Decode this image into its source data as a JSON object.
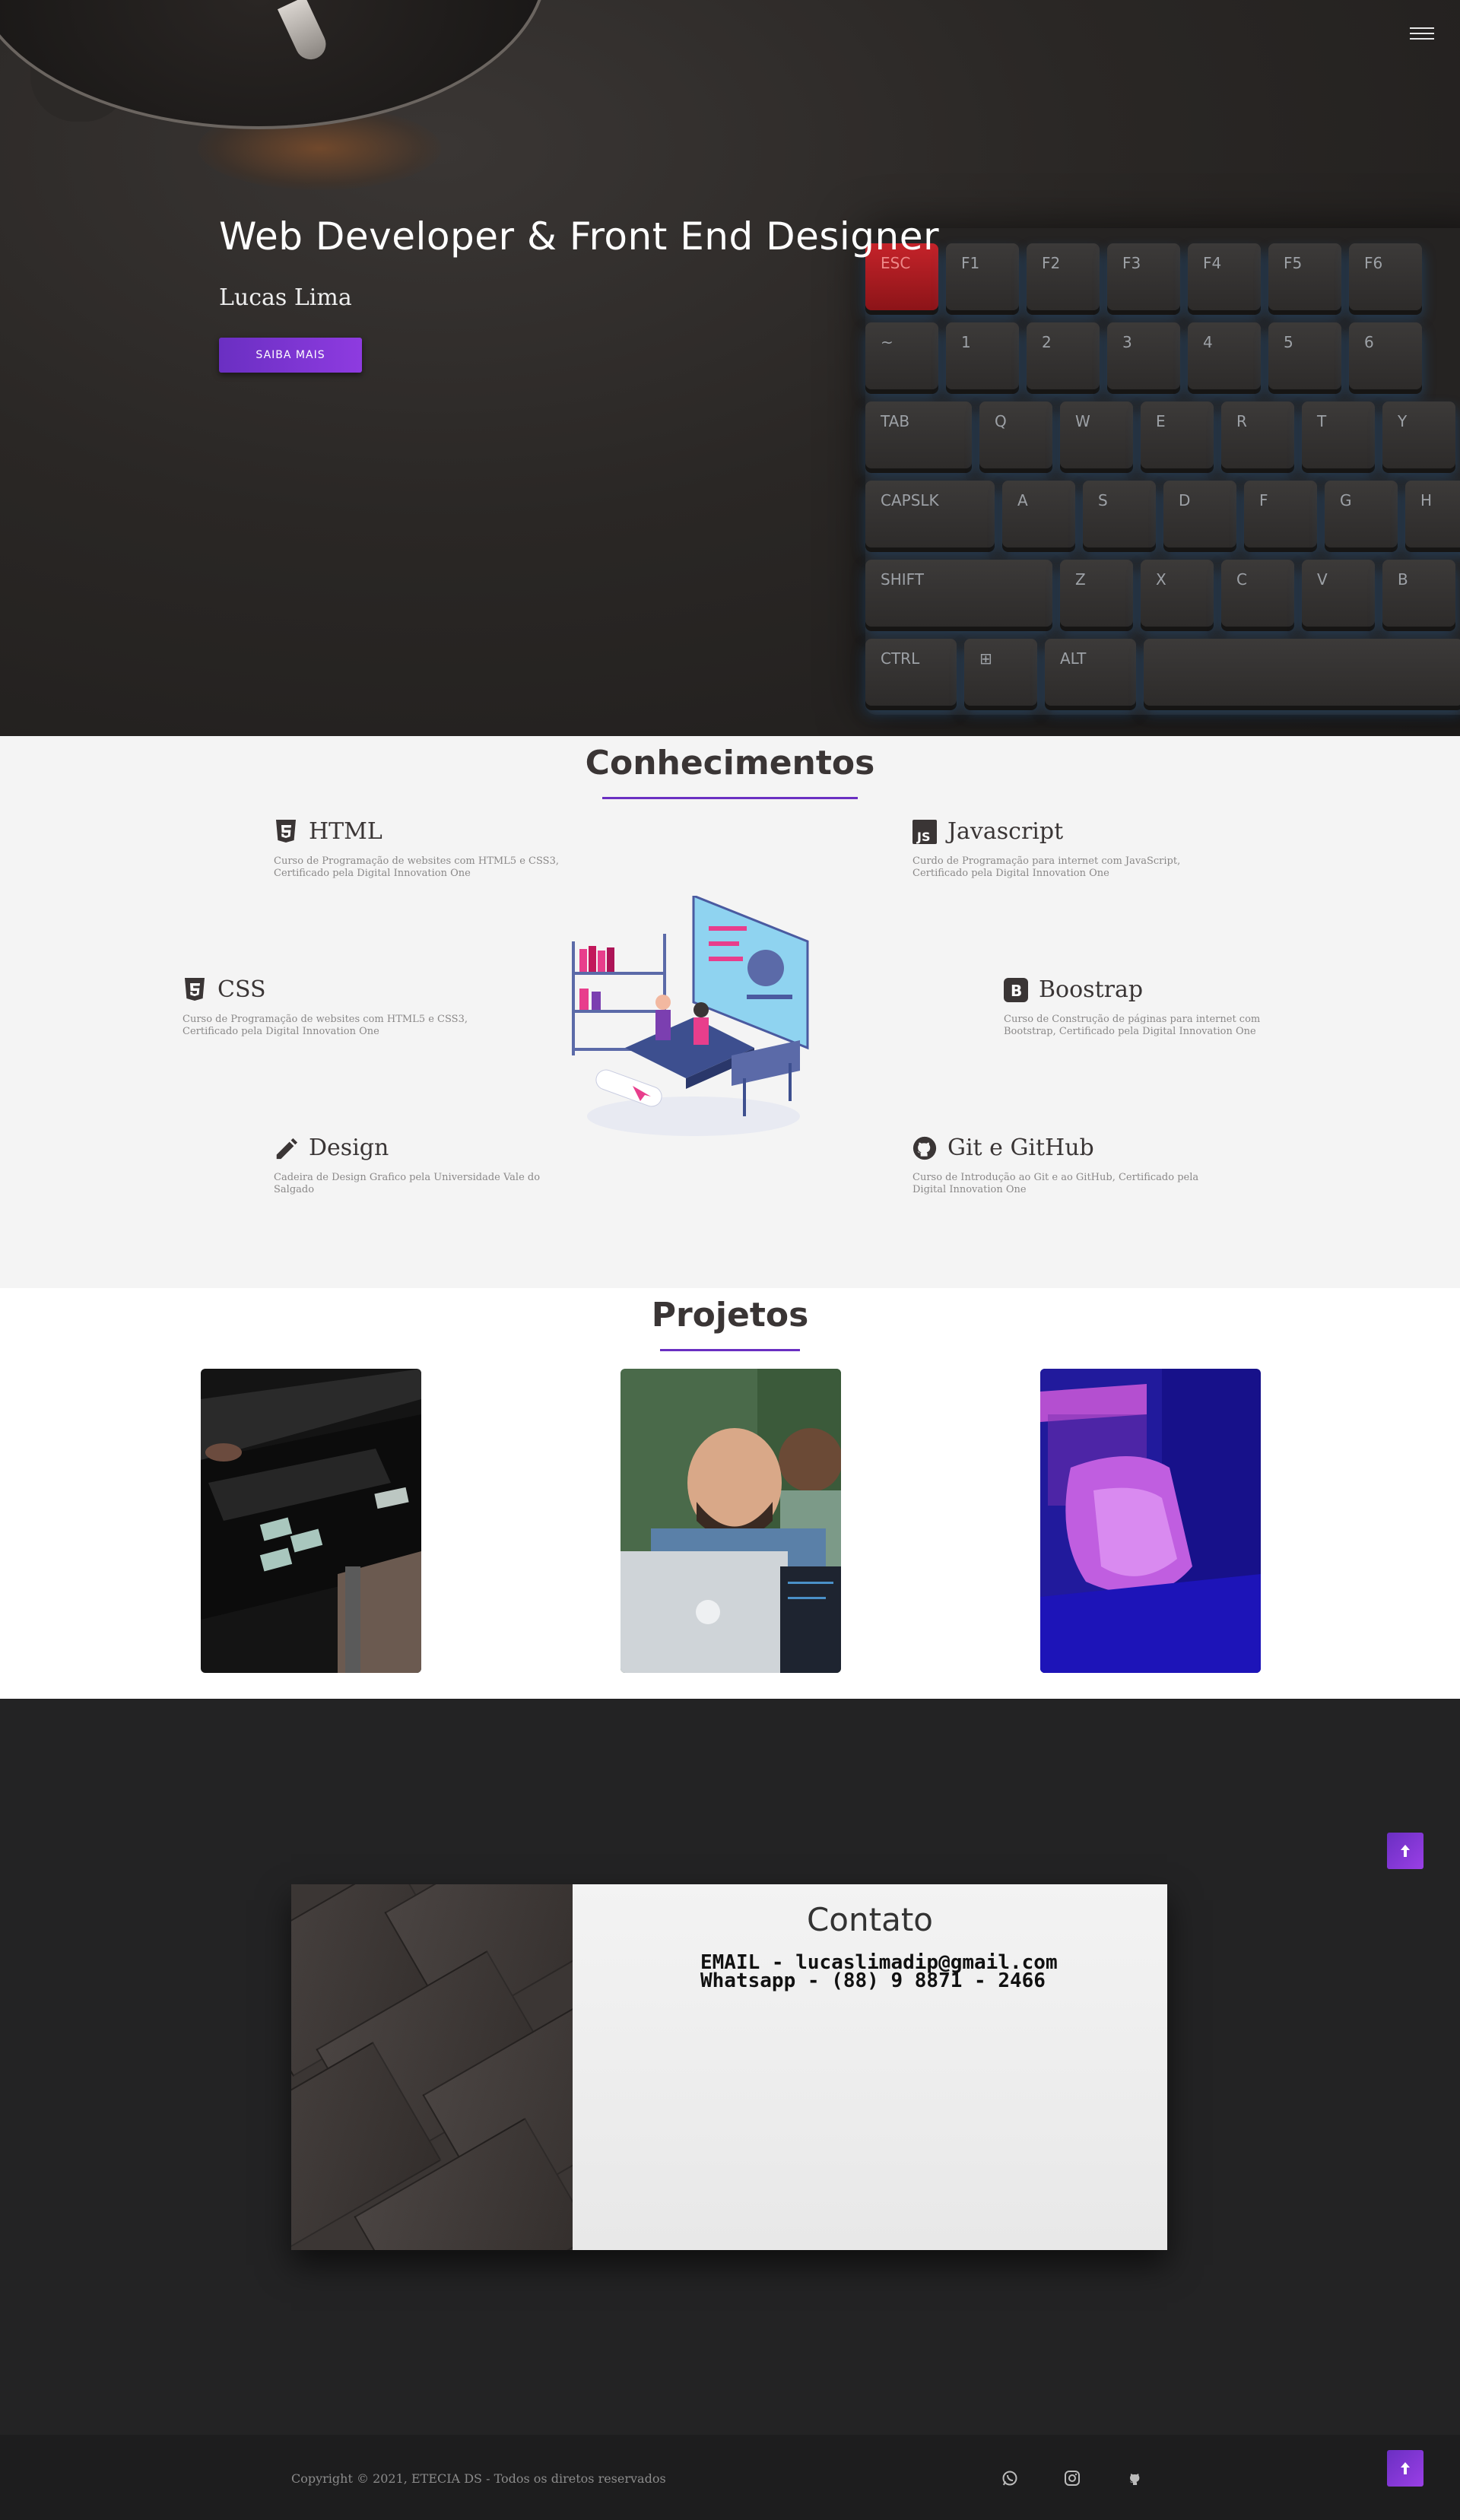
{
  "hero": {
    "title": "Web Developer & Front End Designer",
    "subtitle": "Lucas Lima",
    "cta_label": "SAIBA MAIS",
    "keys": {
      "row1": [
        "ESC",
        "F1",
        "F2",
        "F3",
        "F4",
        "F5",
        "F6"
      ],
      "row2": [
        "~",
        "1",
        "2",
        "3",
        "4",
        "5",
        "6"
      ],
      "row3": [
        "TAB",
        "Q",
        "W",
        "E",
        "R",
        "T",
        "Y"
      ],
      "row4": [
        "CAPSLK",
        "A",
        "S",
        "D",
        "F",
        "G",
        "H"
      ],
      "row5": [
        "SHIFT",
        "Z",
        "X",
        "C",
        "V",
        "B"
      ],
      "row6": [
        "CTRL",
        "⊞",
        "ALT",
        ""
      ]
    }
  },
  "skills": {
    "title": "Conhecimentos",
    "items": [
      {
        "name": "HTML",
        "icon": "html5-icon",
        "desc": "Curso de Programação de websites com HTML5 e CSS3, Certificado pela Digital Innovation One"
      },
      {
        "name": "Javascript",
        "icon": "js-icon",
        "desc": "Curdo de Programação para internet com JavaScript, Certificado pela Digital Innovation One"
      },
      {
        "name": "CSS",
        "icon": "css3-icon",
        "desc": "Curso de Programação de websites com HTML5 e CSS3, Certificado pela Digital Innovation One"
      },
      {
        "name": "Boostrap",
        "icon": "bootstrap-icon",
        "desc": "Curso de Construção de páginas para internet com Bootstrap, Certificado pela Digital Innovation One"
      },
      {
        "name": "Design",
        "icon": "pencil-icon",
        "desc": "Cadeira de Design Grafico pela Universidade Vale do Salgado"
      },
      {
        "name": "Git e GitHub",
        "icon": "github-icon",
        "desc": "Curso de Introdução ao Git e ao GitHub, Certificado pela Digital Innovation One"
      }
    ]
  },
  "projects": {
    "title": "Projetos",
    "images": [
      "desk-keyboard-photo",
      "developers-laptop-photo",
      "purple-pillow-photo"
    ]
  },
  "contact": {
    "title": "Contato",
    "email_line": "EMAIL - lucaslimadip@gmail.com",
    "phone_line": "Whatsapp - (88) 9 8871 - 2466"
  },
  "footer": {
    "copyright": "Copyright © 2021, ETECIA DS - Todos os diretos reservados",
    "social": [
      "whatsapp-icon",
      "instagram-icon",
      "github-icon"
    ]
  },
  "colors": {
    "accent": "#6a2fc2",
    "dark_bg": "#232324",
    "light_bg": "#f4f4f4"
  }
}
